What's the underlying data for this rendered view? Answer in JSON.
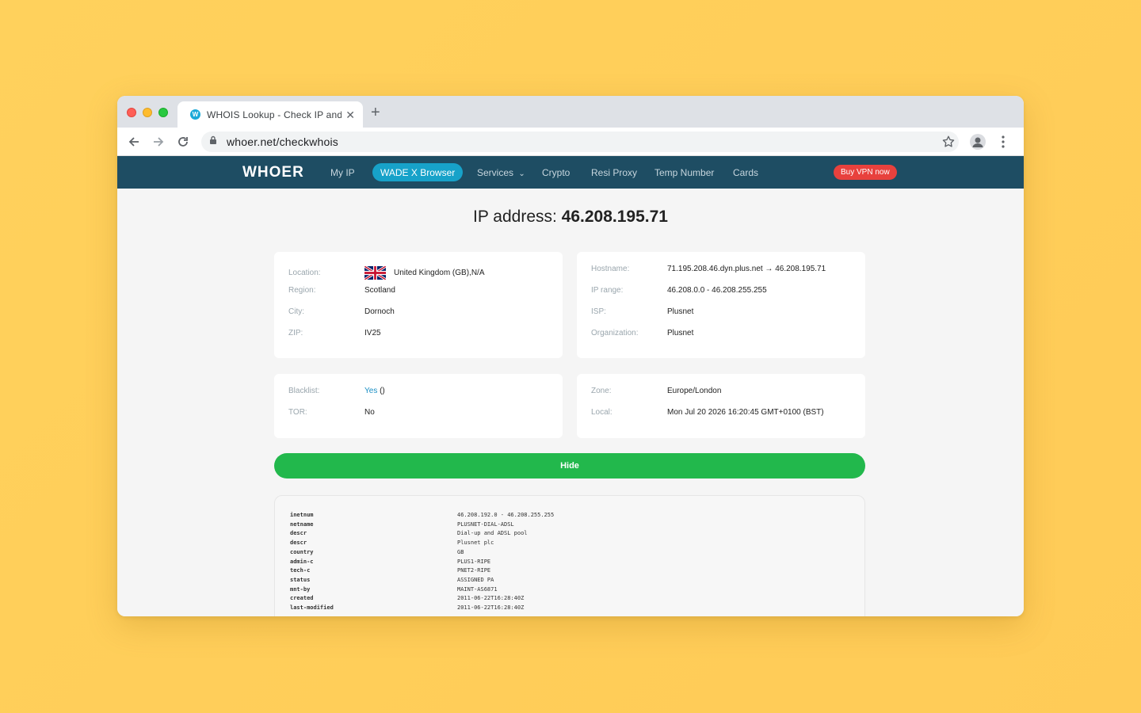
{
  "browser": {
    "tab_title": "WHOIS Lookup - Check IP and",
    "tab_favicon": "W",
    "url": "whoer.net/checkwhois"
  },
  "nav": {
    "logo": "WHOER",
    "items": [
      "My IP",
      "WADE X Browser",
      "Services",
      "Crypto",
      "Resi Proxy",
      "Temp Number",
      "Cards"
    ],
    "services_chevron": "⌄",
    "buy_label": "Buy VPN now"
  },
  "heading": {
    "prefix": "IP address:",
    "ip": "46.208.195.71"
  },
  "location_card": {
    "rows": [
      {
        "label": "Location:",
        "value": "United Kingdom (GB),N/A"
      },
      {
        "label": "Region:",
        "value": "Scotland"
      },
      {
        "label": "City:",
        "value": "Dornoch"
      },
      {
        "label": "ZIP:",
        "value": "IV25"
      }
    ]
  },
  "host_card": {
    "rows": [
      {
        "label": "Hostname:",
        "value": "71.195.208.46.dyn.plus.net → 46.208.195.71"
      },
      {
        "label": "IP range:",
        "value": "46.208.0.0 - 46.208.255.255"
      },
      {
        "label": "ISP:",
        "value": "Plusnet"
      },
      {
        "label": "Organization:",
        "value": "Plusnet"
      }
    ]
  },
  "blacklist_card": {
    "blacklist_label": "Blacklist:",
    "blacklist_link": "Yes",
    "blacklist_suffix": " ()",
    "tor_label": "TOR:",
    "tor_value": "No"
  },
  "zone_card": {
    "rows": [
      {
        "label": "Zone:",
        "value": "Europe/London"
      },
      {
        "label": "Local:",
        "value": "Mon Jul 20 2026 16:20:45 GMT+0100 (BST)"
      }
    ]
  },
  "hide_button": "Hide",
  "whois": [
    {
      "key": "inetnum",
      "value": "46.208.192.0 - 46.208.255.255"
    },
    {
      "key": "netname",
      "value": "PLUSNET-DIAL-ADSL"
    },
    {
      "key": "descr",
      "value": "Dial-up and ADSL pool"
    },
    {
      "key": "descr",
      "value": "Plusnet plc"
    },
    {
      "key": "country",
      "value": "GB"
    },
    {
      "key": "admin-c",
      "value": "PLUS1-RIPE"
    },
    {
      "key": "tech-c",
      "value": "PNET2-RIPE"
    },
    {
      "key": "status",
      "value": "ASSIGNED PA"
    },
    {
      "key": "mnt-by",
      "value": "MAINT-AS6871"
    },
    {
      "key": "created",
      "value": "2011-06-22T16:28:40Z"
    },
    {
      "key": "last-modified",
      "value": "2011-06-22T16:28:40Z"
    }
  ],
  "icons": {
    "back": "back-arrow-icon",
    "forward": "forward-arrow-icon",
    "reload": "reload-icon",
    "lock": "lock-icon",
    "star": "star-icon",
    "profile": "profile-icon",
    "menu": "kebab-menu-icon",
    "flag": "uk-flag-icon"
  },
  "colors": {
    "nav_bg": "#1e4d63",
    "accent_pill": "#17a2c9",
    "buy_button": "#e8413d",
    "hide_button": "#22b84c",
    "page_bg": "#ffcf5a"
  }
}
